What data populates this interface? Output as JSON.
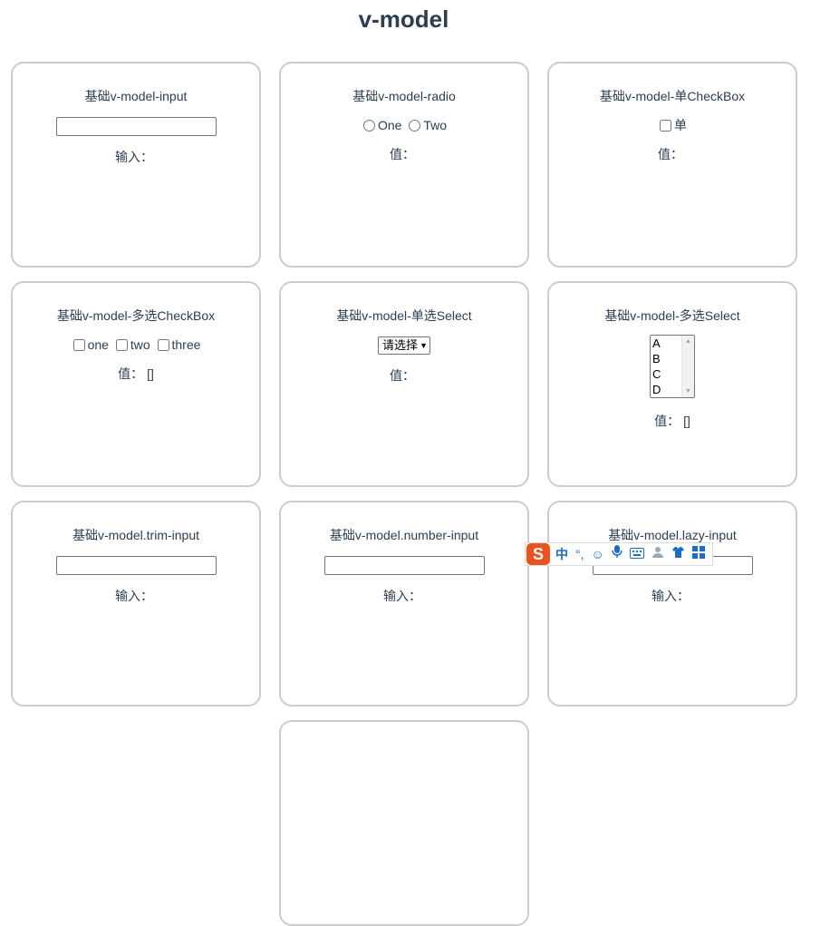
{
  "page": {
    "title": "v-model"
  },
  "cards": {
    "input": {
      "title": "基础v-model-input",
      "value_label": "输入：",
      "value": ""
    },
    "radio": {
      "title": "基础v-model-radio",
      "options": [
        "One",
        "Two"
      ],
      "value_label": "值：",
      "value": ""
    },
    "single_checkbox": {
      "title": "基础v-model-单CheckBox",
      "option": "单",
      "value_label": "值：",
      "value": ""
    },
    "multi_checkbox": {
      "title": "基础v-model-多选CheckBox",
      "options": [
        "one",
        "two",
        "three"
      ],
      "value_label": "值：",
      "value": "[]"
    },
    "single_select": {
      "title": "基础v-model-单选Select",
      "selected": "请选择",
      "value_label": "值：",
      "value": ""
    },
    "multi_select": {
      "title": "基础v-model-多选Select",
      "options": [
        "A",
        "B",
        "C",
        "D"
      ],
      "value_label": "值：",
      "value": "[]"
    },
    "trim_input": {
      "title": "基础v-model.trim-input",
      "value_label": "输入：",
      "value": ""
    },
    "number_input": {
      "title": "基础v-model.number-input",
      "value_label": "输入：",
      "value": ""
    },
    "lazy_input": {
      "title": "基础v-model.lazy-input",
      "value_label": "输入：",
      "value": ""
    }
  },
  "ime_toolbar": {
    "logo": "S",
    "mode": "中",
    "icons": [
      "punctuation-icon",
      "emoji-icon",
      "microphone-icon",
      "keyboard-icon",
      "user-icon",
      "skin-icon",
      "toolbox-icon"
    ]
  }
}
